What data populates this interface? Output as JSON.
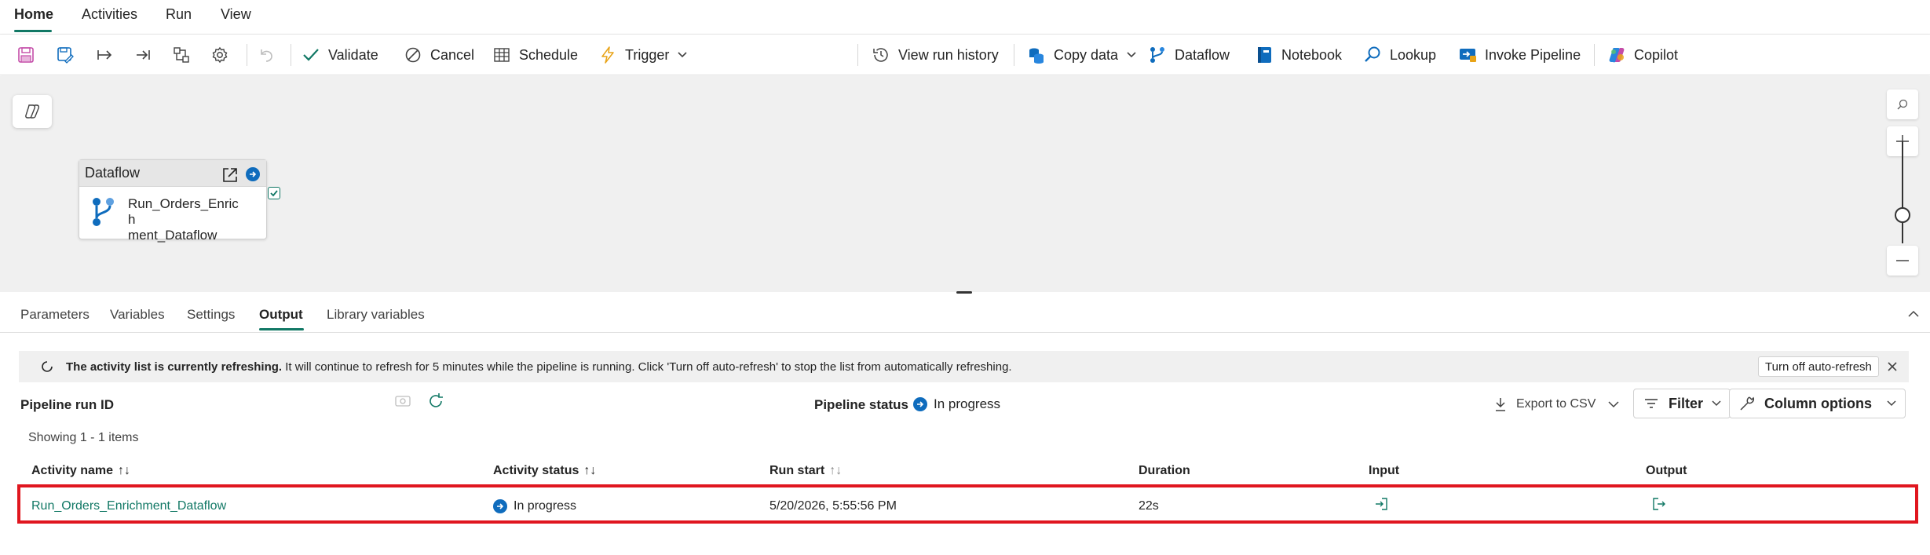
{
  "menu": {
    "tabs": [
      "Home",
      "Activities",
      "Run",
      "View"
    ]
  },
  "toolbar": {
    "validate": "Validate",
    "cancel": "Cancel",
    "schedule": "Schedule",
    "trigger": "Trigger",
    "view_run_history": "View run history",
    "copy_data": "Copy data",
    "dataflow": "Dataflow",
    "notebook": "Notebook",
    "lookup": "Lookup",
    "invoke_pipeline": "Invoke Pipeline",
    "copilot": "Copilot"
  },
  "canvas": {
    "node": {
      "type": "Dataflow",
      "name": "Run_Orders_Enrichment_Dataflow",
      "name_line1": "Run_Orders_Enrich",
      "name_line2": "ment_Dataflow"
    }
  },
  "panel": {
    "tabs": [
      "Parameters",
      "Variables",
      "Settings",
      "Output",
      "Library variables"
    ],
    "active_tab": "Output",
    "banner": {
      "bold_text": "The activity list is currently refreshing.",
      "text": " It will continue to refresh for 5 minutes while the pipeline is running. Click 'Turn off auto-refresh' to stop the list from automatically refreshing.",
      "button": "Turn off auto-refresh"
    },
    "pipeline_run_id_label": "Pipeline run ID",
    "pipeline_status_label": "Pipeline status",
    "pipeline_status_value": "In progress",
    "export_csv": "Export to CSV",
    "filter": "Filter",
    "column_options": "Column options",
    "showing": "Showing 1 - 1 items",
    "table": {
      "headers": [
        "Activity name",
        "Activity status",
        "Run start",
        "Duration",
        "Input",
        "Output"
      ],
      "rows": [
        {
          "activity_name": "Run_Orders_Enrichment_Dataflow",
          "status": "In progress",
          "run_start": "5/20/2026, 5:55:56 PM",
          "duration": "22s"
        }
      ]
    }
  },
  "colors": {
    "accent": "#117865",
    "status_blue": "#0f6cbd",
    "highlight_red": "#e0161f"
  },
  "icons": [
    "save-icon",
    "save-as-icon",
    "run-step-icon",
    "run-to-end-icon",
    "auto-layout-icon",
    "settings-gear-icon",
    "undo-icon",
    "checkmark-icon",
    "cancel-circle-icon",
    "calendar-grid-icon",
    "lightning-icon",
    "history-icon",
    "copy-data-icon",
    "dataflow-icon",
    "notebook-icon",
    "lookup-icon",
    "invoke-pipeline-icon",
    "copilot-icon",
    "search-icon",
    "zoom-in-icon",
    "zoom-out-icon",
    "refresh-icon",
    "download-icon",
    "filter-icon",
    "wrench-icon",
    "close-icon",
    "chevron-down-icon",
    "chevron-up-icon",
    "input-icon",
    "output-icon",
    "external-link-icon"
  ]
}
